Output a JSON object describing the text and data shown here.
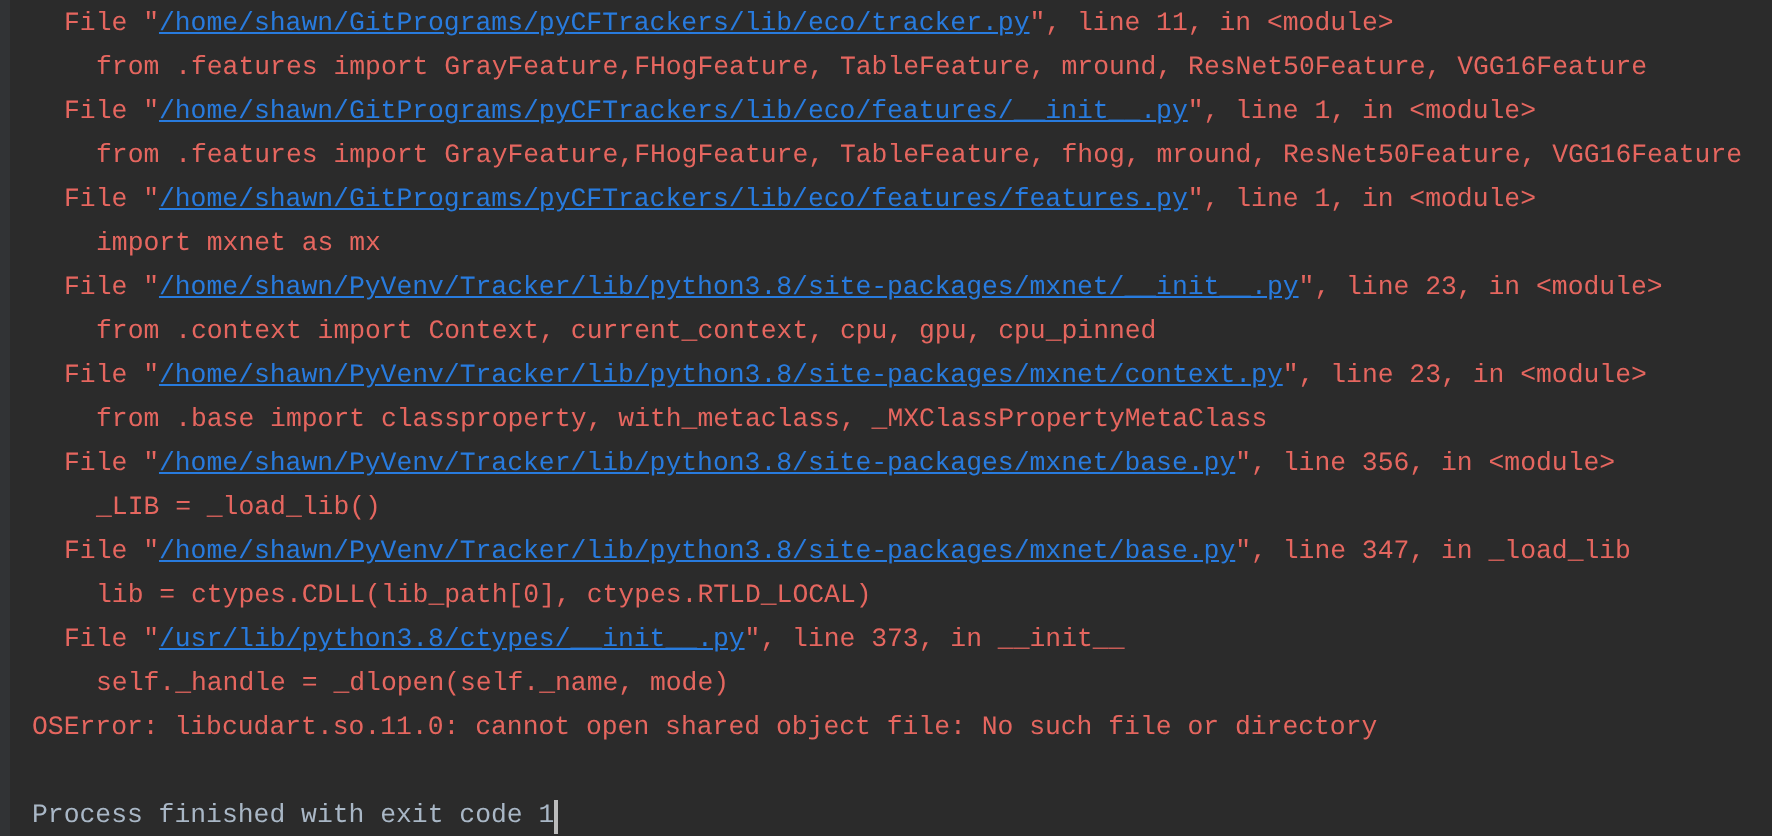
{
  "console": {
    "lines": [
      {
        "kind": "file",
        "prefix": "File \"",
        "path": "/home/shawn/GitPrograms/pyCFTrackers/lib/eco/tracker.py",
        "suffix": "\", line 11, in <module>"
      },
      {
        "kind": "code",
        "text": "from .features import GrayFeature,FHogFeature, TableFeature, mround, ResNet50Feature, VGG16Feature"
      },
      {
        "kind": "file",
        "prefix": "File \"",
        "path": "/home/shawn/GitPrograms/pyCFTrackers/lib/eco/features/__init__.py",
        "suffix": "\", line 1, in <module>"
      },
      {
        "kind": "code",
        "text": "from .features import GrayFeature,FHogFeature, TableFeature, fhog, mround, ResNet50Feature, VGG16Feature"
      },
      {
        "kind": "file",
        "prefix": "File \"",
        "path": "/home/shawn/GitPrograms/pyCFTrackers/lib/eco/features/features.py",
        "suffix": "\", line 1, in <module>"
      },
      {
        "kind": "code",
        "text": "import mxnet as mx"
      },
      {
        "kind": "file",
        "prefix": "File \"",
        "path": "/home/shawn/PyVenv/Tracker/lib/python3.8/site-packages/mxnet/__init__.py",
        "suffix": "\", line 23, in <module>"
      },
      {
        "kind": "code",
        "text": "from .context import Context, current_context, cpu, gpu, cpu_pinned"
      },
      {
        "kind": "file",
        "prefix": "File \"",
        "path": "/home/shawn/PyVenv/Tracker/lib/python3.8/site-packages/mxnet/context.py",
        "suffix": "\", line 23, in <module>"
      },
      {
        "kind": "code",
        "text": "from .base import classproperty, with_metaclass, _MXClassPropertyMetaClass"
      },
      {
        "kind": "file",
        "prefix": "File \"",
        "path": "/home/shawn/PyVenv/Tracker/lib/python3.8/site-packages/mxnet/base.py",
        "suffix": "\", line 356, in <module>"
      },
      {
        "kind": "code",
        "text": "_LIB = _load_lib()"
      },
      {
        "kind": "file",
        "prefix": "File \"",
        "path": "/home/shawn/PyVenv/Tracker/lib/python3.8/site-packages/mxnet/base.py",
        "suffix": "\", line 347, in _load_lib"
      },
      {
        "kind": "code",
        "text": "lib = ctypes.CDLL(lib_path[0], ctypes.RTLD_LOCAL)"
      },
      {
        "kind": "file",
        "prefix": "File \"",
        "path": "/usr/lib/python3.8/ctypes/__init__.py",
        "suffix": "\", line 373, in __init__"
      },
      {
        "kind": "code",
        "text": "self._handle = _dlopen(self._name, mode)"
      },
      {
        "kind": "error",
        "text": "OSError: libcudart.so.11.0: cannot open shared object file: No such file or directory"
      },
      {
        "kind": "blank"
      },
      {
        "kind": "status",
        "text": "Process finished with exit code 1",
        "cursor": true
      }
    ]
  }
}
